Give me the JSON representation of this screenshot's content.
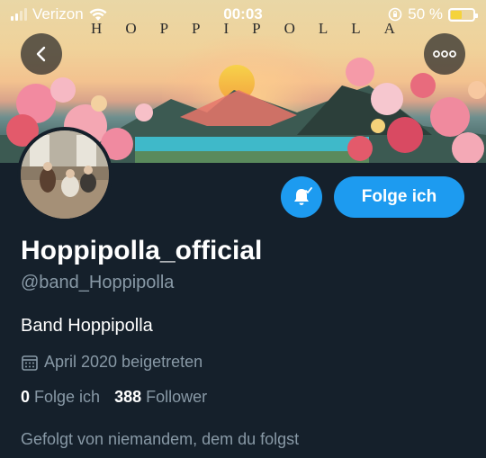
{
  "status_bar": {
    "carrier": "Verizon",
    "time": "00:03",
    "battery_percent": "50 %"
  },
  "banner": {
    "title": "HOPPIPOLLA",
    "colors": {
      "sky": "#f0d29a",
      "sun": "#f7d24a",
      "lake": "#3fb9c9",
      "flowers": "#f0728a"
    }
  },
  "profile": {
    "display_name": "Hoppipolla_official",
    "handle": "@band_Hoppipolla",
    "bio": "Band Hoppipolla",
    "joined": "April 2020 beigetreten",
    "following_count": "0",
    "following_label": "Folge ich",
    "followers_count": "388",
    "followers_label": "Follower",
    "followed_by": "Gefolgt von niemandem, dem du folgst"
  },
  "actions": {
    "follow_button_label": "Folge ich",
    "accent_color": "#1d9bf0"
  },
  "icons": {
    "back": "chevron-left-icon",
    "more": "more-icon",
    "bell": "bell-icon",
    "calendar": "calendar-icon"
  }
}
